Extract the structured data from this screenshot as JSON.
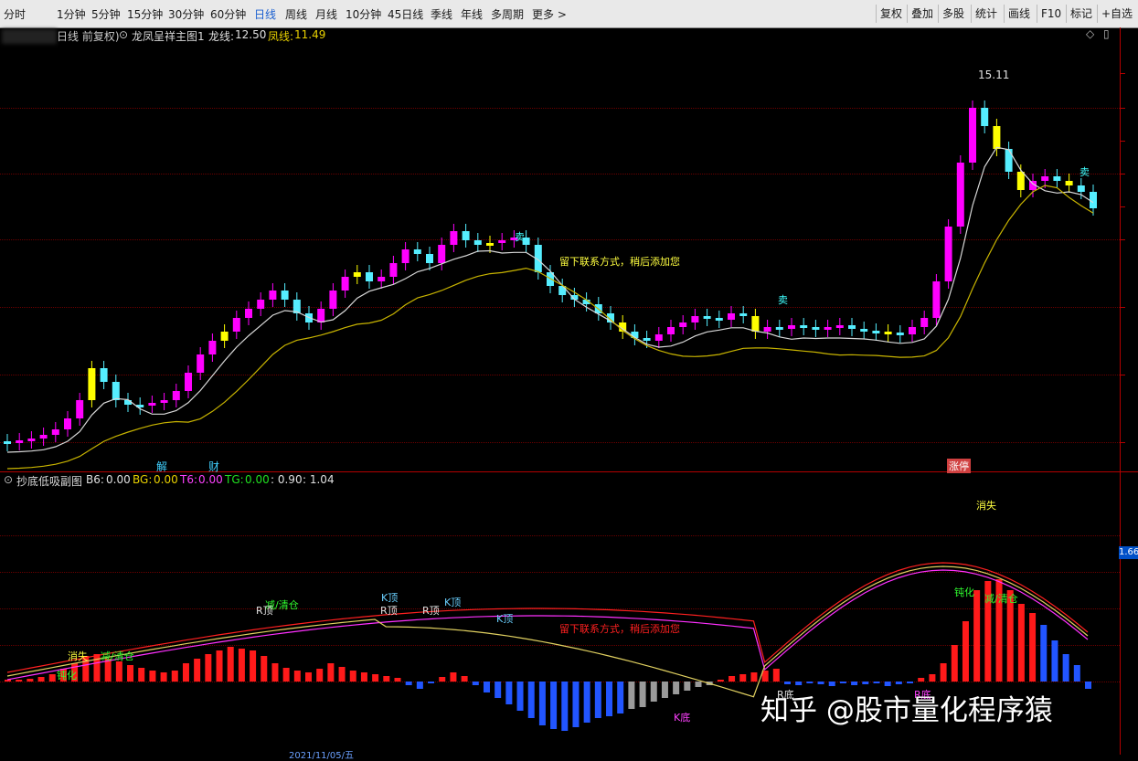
{
  "toolbar": {
    "periods": [
      "分时",
      "1分钟",
      "5分钟",
      "15分钟",
      "30分钟",
      "60分钟",
      "日线",
      "周线",
      "月线",
      "10分钟",
      "45日线",
      "季线",
      "年线",
      "多周期",
      "更多 >"
    ],
    "active_period": "日线",
    "right_buttons": [
      "复权",
      "叠加",
      "多股",
      "统计",
      "画线",
      "F10",
      "标记",
      "+自选"
    ]
  },
  "main_panel": {
    "adjust_label": "日线 前复权)",
    "indicator_name": "龙凤呈祥主图1",
    "long_label": "龙线:",
    "long_value": "12.50",
    "phoenix_label": "凤线:",
    "phoenix_value": "11.49",
    "high_price_label": "15.11",
    "note": "留下联系方式，稍后添加您",
    "sell_label": "卖",
    "event_labels": [
      "解",
      "财",
      "涨停"
    ]
  },
  "sub_panel": {
    "indicator_name": "抄底低吸副图",
    "b6_label": "B6:",
    "b6_value": "0.00",
    "bg_label": "BG:",
    "bg_value": "0.00",
    "t6_label": "T6:",
    "t6_value": "0.00",
    "tg_label": "TG:",
    "tg_value": "0.00",
    "v1": "0.90",
    "v2": "1.04",
    "axis_value": "1.66",
    "note": "留下联系方式，稍后添加您",
    "signals": [
      "消失",
      "减/清仓",
      "钝化",
      "R顶",
      "K顶",
      "K底",
      "R底"
    ]
  },
  "bottom_axis": {
    "date_label": "2021/11/05/五"
  },
  "watermark": "知乎 @股市量化程序猿",
  "colors": {
    "up_candle": "#ff00ff",
    "down_candle": "#55eeff",
    "yellow_candle": "#ffff00",
    "long_line": "#d8d8d8",
    "phoenix_line": "#c8b400",
    "red_bar": "#ff1a1a",
    "blue_bar": "#2255ff",
    "gray_bar": "#9a9a9a"
  }
}
